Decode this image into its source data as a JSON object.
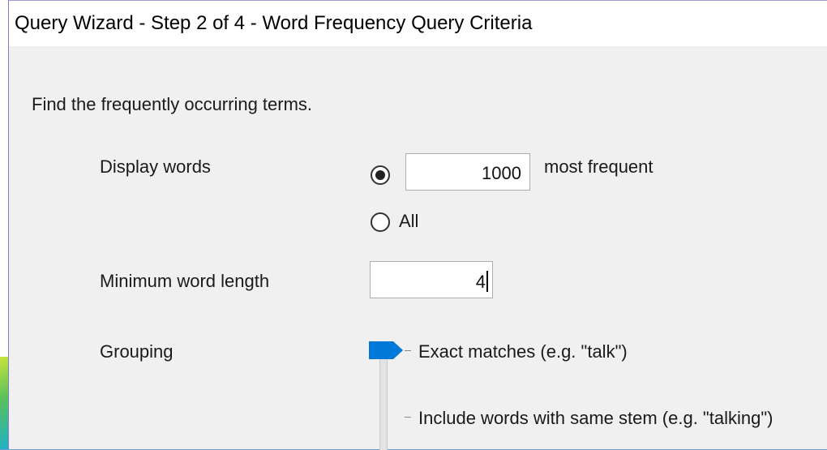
{
  "dialog": {
    "title": "Query Wizard - Step 2 of 4 - Word Frequency Query Criteria",
    "intro": "Find the frequently occurring terms."
  },
  "display_words": {
    "label": "Display words",
    "count_value": "1000",
    "count_suffix": "most frequent",
    "all_label": "All",
    "selected": "count"
  },
  "min_length": {
    "label": "Minimum word length",
    "value": "4"
  },
  "grouping": {
    "label": "Grouping",
    "options": [
      "Exact matches (e.g. \"talk\")",
      "Include words with same stem (e.g. \"talking\")"
    ],
    "selected_index": 0
  },
  "colors": {
    "accent": "#0078d7"
  }
}
